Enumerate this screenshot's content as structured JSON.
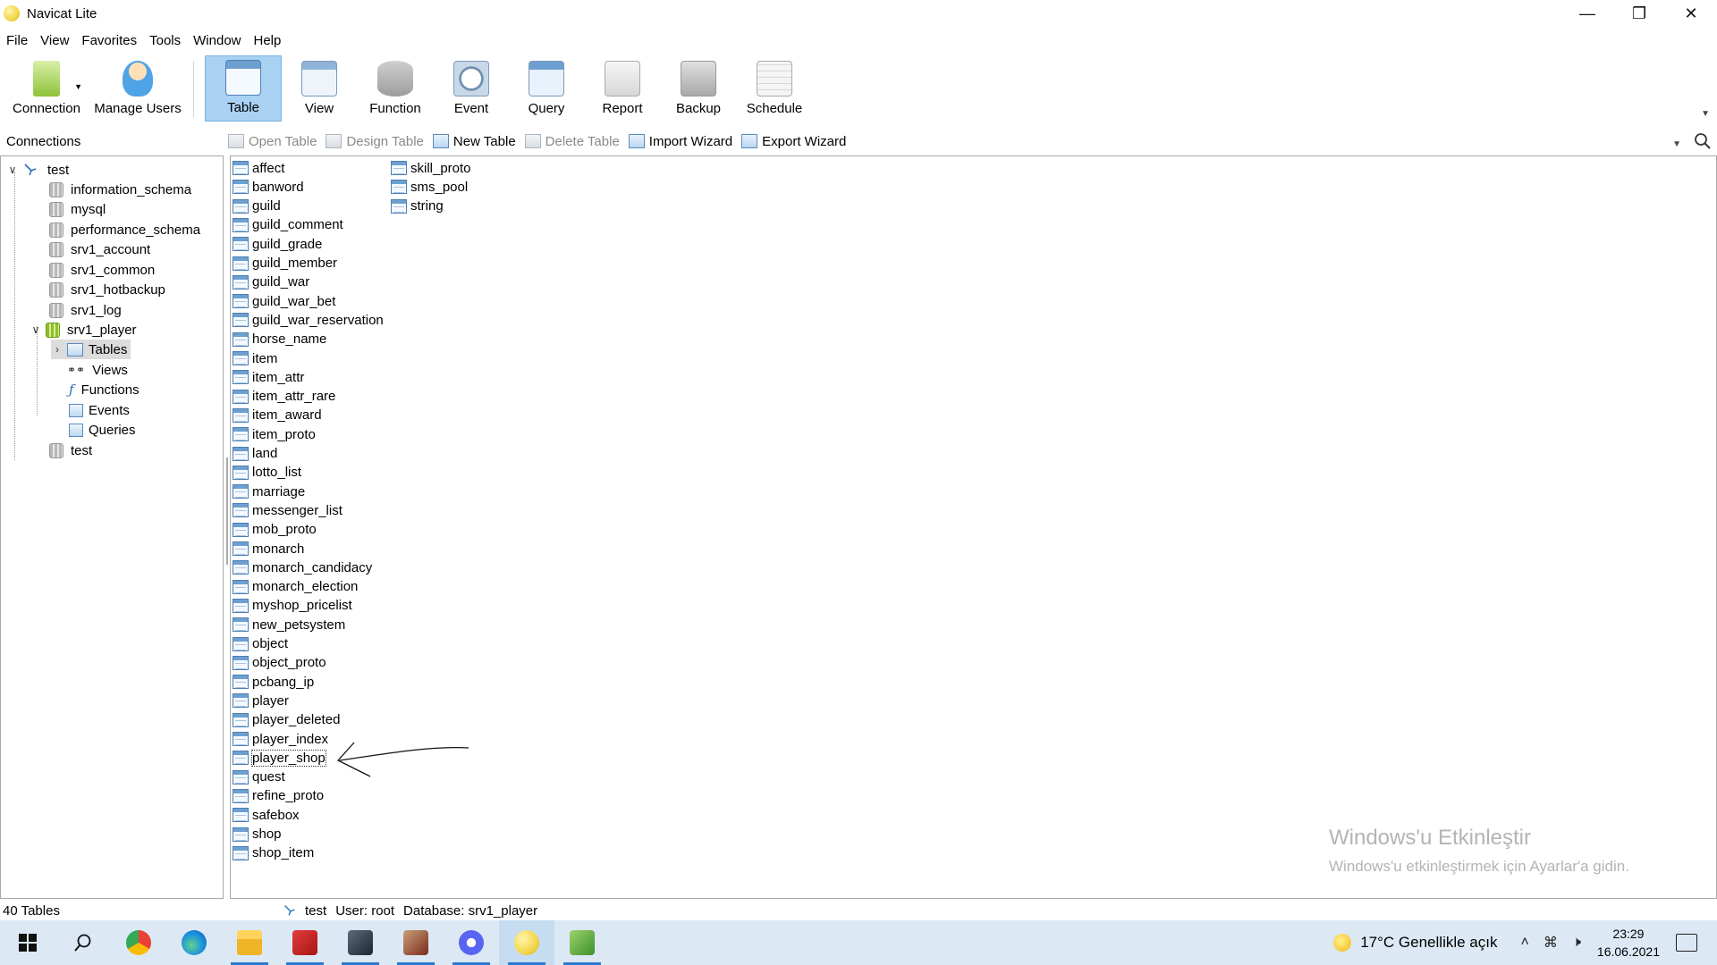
{
  "window": {
    "title": "Navicat Lite",
    "controls": [
      "minimize-icon",
      "restore-icon",
      "close-icon"
    ]
  },
  "menu": [
    "File",
    "View",
    "Favorites",
    "Tools",
    "Window",
    "Help"
  ],
  "toolbar": [
    {
      "label": "Connection",
      "icon": "connection-icon"
    },
    {
      "label": "Manage Users",
      "icon": "user-icon"
    },
    {
      "label": "Table",
      "icon": "table-icon",
      "active": true
    },
    {
      "label": "View",
      "icon": "view-icon"
    },
    {
      "label": "Function",
      "icon": "function-icon"
    },
    {
      "label": "Event",
      "icon": "event-icon"
    },
    {
      "label": "Query",
      "icon": "query-icon"
    },
    {
      "label": "Report",
      "icon": "report-icon"
    },
    {
      "label": "Backup",
      "icon": "backup-icon"
    },
    {
      "label": "Schedule",
      "icon": "schedule-icon"
    }
  ],
  "connections_label": "Connections",
  "object_actions": [
    {
      "label": "Open Table",
      "enabled": false
    },
    {
      "label": "Design Table",
      "enabled": false
    },
    {
      "label": "New Table",
      "enabled": true
    },
    {
      "label": "Delete Table",
      "enabled": false
    },
    {
      "label": "Import Wizard",
      "enabled": true
    },
    {
      "label": "Export Wizard",
      "enabled": true
    }
  ],
  "tree": {
    "connection": "test",
    "databases": [
      "information_schema",
      "mysql",
      "performance_schema",
      "srv1_account",
      "srv1_common",
      "srv1_hotbackup",
      "srv1_log",
      "srv1_player"
    ],
    "open_database": "srv1_player",
    "children": [
      "Tables",
      "Views",
      "Functions",
      "Events",
      "Queries"
    ],
    "selected_child": "Tables",
    "last_database": "test"
  },
  "tables": [
    "affect",
    "banword",
    "guild",
    "guild_comment",
    "guild_grade",
    "guild_member",
    "guild_war",
    "guild_war_bet",
    "guild_war_reservation",
    "horse_name",
    "item",
    "item_attr",
    "item_attr_rare",
    "item_award",
    "item_proto",
    "land",
    "lotto_list",
    "marriage",
    "messenger_list",
    "mob_proto",
    "monarch",
    "monarch_candidacy",
    "monarch_election",
    "myshop_pricelist",
    "new_petsystem",
    "object",
    "object_proto",
    "pcbang_ip",
    "player",
    "player_deleted",
    "player_index",
    "player_shop",
    "quest",
    "refine_proto",
    "safebox",
    "shop",
    "shop_item",
    "skill_proto",
    "sms_pool",
    "string"
  ],
  "focused_table": "player_shop",
  "watermark": {
    "title": "Windows'u Etkinleştir",
    "subtitle": "Windows'u etkinleştirmek için Ayarlar'a gidin."
  },
  "status": {
    "count": "40 Tables",
    "connection": "test",
    "user": "User: root",
    "database": "Database: srv1_player"
  },
  "taskbar": {
    "apps": [
      "start-icon",
      "search-icon",
      "chrome-icon",
      "edge-icon",
      "file-explorer-icon",
      "pdf-app-icon",
      "app-icon",
      "game-app-icon",
      "discord-icon",
      "navicat-icon",
      "editor-icon"
    ],
    "weather": "17°C  Genellikle açık",
    "time": "23:29",
    "date": "16.06.2021",
    "colors": {
      "taskbar_bg": "#dce9f5",
      "active_indicator": "#2a7bd1"
    }
  },
  "colors": {
    "active_tool": "#a9d1f2",
    "watermark": "#b4b4b4"
  }
}
